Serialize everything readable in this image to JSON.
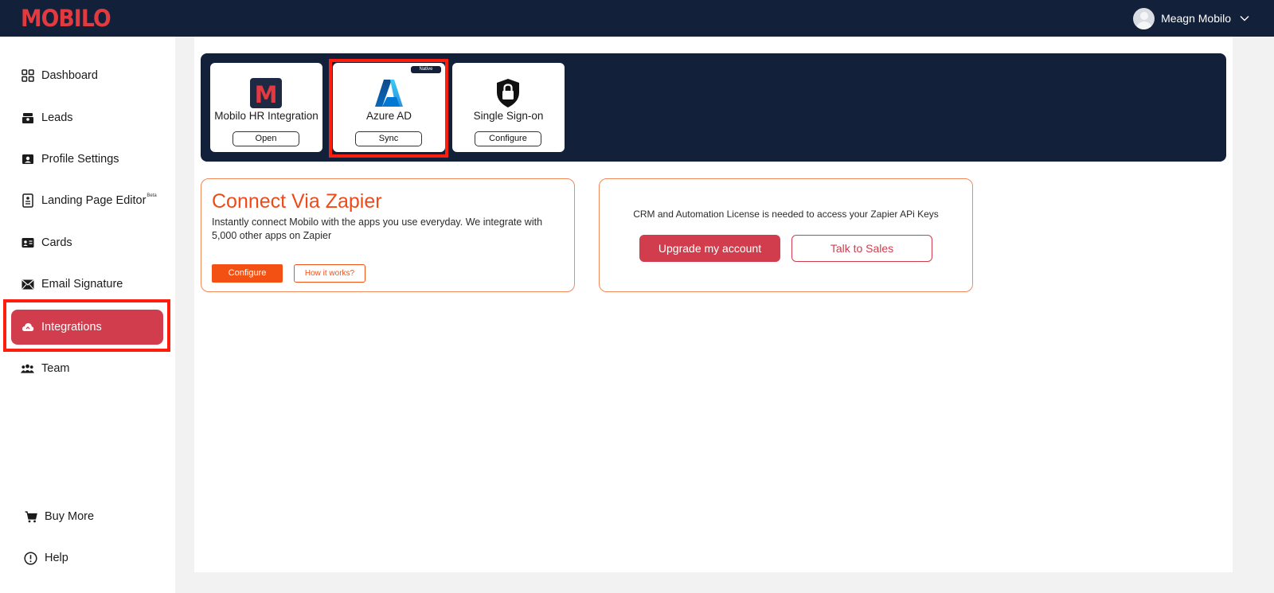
{
  "app": {
    "logo_text": "MOBILO",
    "brand_color": "#e23a3f",
    "header_bg": "#13203a",
    "accent_red": "#d13d4c",
    "accent_orange": "#f25113"
  },
  "user": {
    "name": "Meagn Mobilo",
    "menu_icon": "chevron-down-icon",
    "avatar_icon": "avatar"
  },
  "sidebar": {
    "items": [
      {
        "label": "Dashboard",
        "icon": "dashboard-grid-icon",
        "active": false
      },
      {
        "label": "Leads",
        "icon": "leads-icon",
        "active": false
      },
      {
        "label": "Profile Settings",
        "icon": "profile-card-icon",
        "active": false
      },
      {
        "label": "Landing Page Editor",
        "badge": "Beta",
        "icon": "document-icon",
        "active": false
      },
      {
        "label": "Cards",
        "icon": "id-card-icon",
        "active": false
      },
      {
        "label": "Email Signature",
        "icon": "envelope-icon",
        "active": false
      },
      {
        "label": "Integrations",
        "icon": "cloud-icon",
        "active": true
      },
      {
        "label": "Team",
        "icon": "team-icon",
        "active": false
      }
    ],
    "footer": [
      {
        "label": "Buy More",
        "icon": "cart-icon"
      },
      {
        "label": "Help",
        "icon": "info-circle-icon"
      }
    ]
  },
  "integrations": [
    {
      "title": "Mobilo HR Integration",
      "button": "Open",
      "icon": "mobilo-m-icon"
    },
    {
      "title": "Azure AD",
      "button": "Sync",
      "badge": "Native",
      "icon": "azure-icon"
    },
    {
      "title": "Single Sign-on",
      "button": "Configure",
      "icon": "shield-lock-icon"
    }
  ],
  "zapier": {
    "title": "Connect Via Zapier",
    "description": "Instantly connect Mobilo with the apps you use everyday. We integrate with 5,000 other apps on Zapier",
    "configure_label": "Configure",
    "how_label": "How it works?"
  },
  "license": {
    "text": "CRM and Automation License is needed to access your Zapier APi Keys",
    "upgrade_label": "Upgrade my account",
    "sales_label": "Talk to Sales"
  }
}
